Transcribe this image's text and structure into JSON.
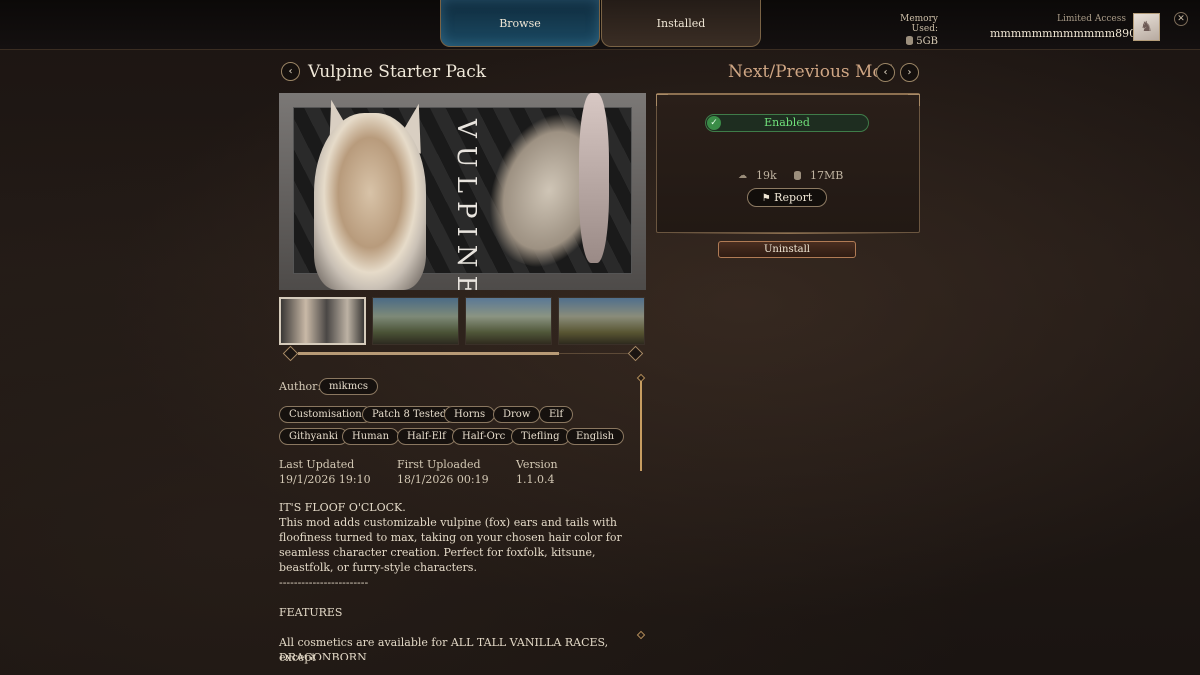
{
  "header": {
    "tabs": [
      {
        "label": "Browse",
        "active": true
      },
      {
        "label": "Installed",
        "active": false
      }
    ],
    "memory_label": "Memory Used:",
    "memory_value": "5GB",
    "account_level": "Limited Access",
    "account_name": "mmmmmmmmmmmm890"
  },
  "title_row": {
    "title": "Vulpine Starter Pack",
    "nav_label": "Next/Previous Mod",
    "back_icon": "‹",
    "prev_icon": "‹",
    "next_icon": "›"
  },
  "hero": {
    "word": "VULPINE"
  },
  "thumbnails": [
    "thumb-1",
    "thumb-2",
    "thumb-3",
    "thumb-4"
  ],
  "details": {
    "author_label": "Author:",
    "author": "mikmcs",
    "tags_row1": [
      "Customisation",
      "Patch 8 Tested",
      "Horns",
      "Drow",
      "Elf"
    ],
    "tags_row2": [
      "Githyanki",
      "Human",
      "Half-Elf",
      "Half-Orc",
      "Tiefling",
      "English"
    ],
    "last_updated_label": "Last Updated",
    "last_updated": "19/1/2026 19:10",
    "first_uploaded_label": "First Uploaded",
    "first_uploaded": "18/1/2026 00:19",
    "version_label": "Version",
    "version": "1.1.0.4",
    "desc_heading": "IT'S FLOOF O'CLOCK.",
    "desc_body": "This mod adds customizable vulpine (fox) ears and tails with floofiness turned to max, taking on your chosen hair color for seamless character creation. Perfect for foxfolk, kitsune, beastfolk, or furry-style characters.",
    "separator": "------------------------",
    "features_heading": "FEATURES",
    "features_text": "All cosmetics are available for ALL TALL VANILLA RACES, except",
    "features_cut": "DRAGONBORN"
  },
  "panel": {
    "status": "Enabled",
    "downloads": "19k",
    "size": "17MB",
    "report_label": "Report",
    "uninstall_label": "Uninstall"
  },
  "colors": {
    "accent_gold": "#b79a76",
    "enabled_green": "#6fe07a",
    "browse_blue": "#1b4a63"
  }
}
